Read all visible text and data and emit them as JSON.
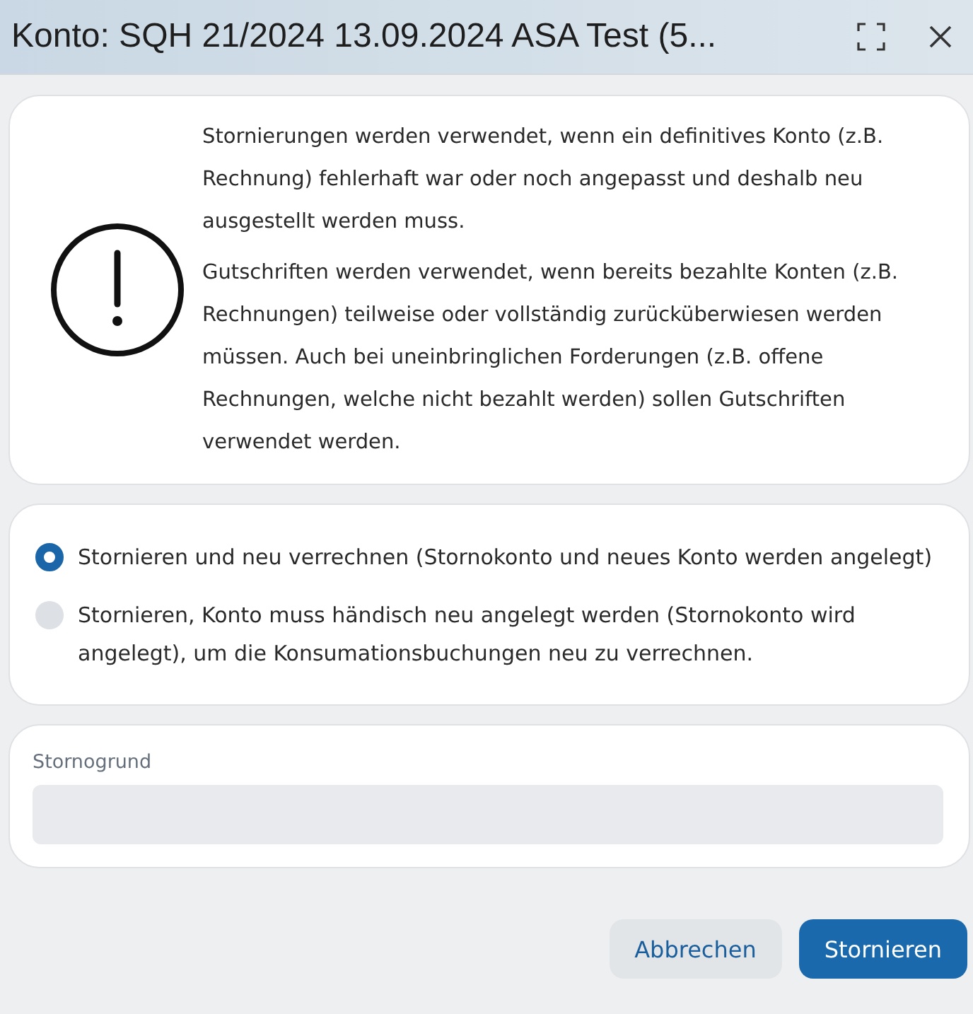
{
  "window": {
    "title": "Konto: SQH 21/2024 13.09.2024 ASA Test (5..."
  },
  "info": {
    "paragraphs": [
      "Stornierungen werden verwendet, wenn ein definitives Konto (z.B. Rechnung) fehlerhaft war oder noch angepasst und deshalb neu ausgestellt werden muss.",
      "Gutschriften werden verwendet, wenn bereits bezahlte Konten (z.B. Rechnungen) teilweise oder vollständig zurücküberwiesen werden müssen. Auch bei uneinbringlichen Forderungen (z.B. offene Rechnungen, welche nicht bezahlt werden) sollen Gutschriften verwendet werden."
    ]
  },
  "options": [
    {
      "label": "Stornieren und neu verrechnen (Stornokonto und neues Konto werden angelegt)",
      "selected": true
    },
    {
      "label": "Stornieren, Konto muss händisch neu angelegt werden (Stornokonto wird angelegt), um die Konsumationsbuchungen neu zu verrechnen.",
      "selected": false
    }
  ],
  "reason": {
    "label": "Stornogrund"
  },
  "buttons": [
    {
      "label": "Abbrechen",
      "kind": "secondary"
    },
    {
      "label": "Stornieren",
      "kind": "primary"
    }
  ]
}
